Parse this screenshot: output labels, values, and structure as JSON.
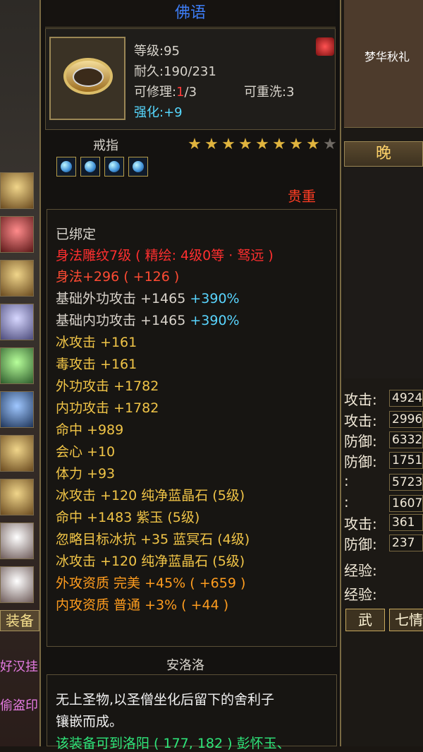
{
  "tooltip": {
    "title": "佛语",
    "level": "等级:95",
    "durability": "耐久:190/231",
    "repair_label": "可修理:",
    "repair_value": "1",
    "repair_total": "/3",
    "rewash": "可重洗:3",
    "enhance_label": "强化:",
    "enhance_value": "+9",
    "item_type": "戒指",
    "stars": 8,
    "total_stars": 9,
    "rarity": "贵重",
    "bound": "已绑定",
    "engraving": "身法雕纹7级 ( 精绘: 4级0等 · 驽远 )",
    "lines": [
      {
        "text": "身法+296 ( +126 )",
        "color": "#ff4b33"
      },
      {
        "text": "基础外功攻击 +1465",
        "extra": " +390%",
        "color": "#d9d3cb",
        "extra_color": "#59d5ff"
      },
      {
        "text": "基础内功攻击 +1465",
        "extra": " +390%",
        "color": "#d9d3cb",
        "extra_color": "#59d5ff"
      },
      {
        "text": "冰攻击 +161",
        "color": "#f0c447"
      },
      {
        "text": "毒攻击 +161",
        "color": "#f0c447"
      },
      {
        "text": "外功攻击 +1782",
        "color": "#f0c447"
      },
      {
        "text": "内功攻击 +1782",
        "color": "#f0c447"
      },
      {
        "text": "命中 +989",
        "color": "#f0c447"
      },
      {
        "text": "会心 +10",
        "color": "#f0c447"
      },
      {
        "text": "体力 +93",
        "color": "#f0c447"
      },
      {
        "text": "冰攻击 +120 纯净蓝晶石 (5级)",
        "color": "#f0c447"
      },
      {
        "text": "命中 +1483 紫玉 (5级)",
        "color": "#f0c447"
      },
      {
        "text": "忽略目标冰抗 +35 蓝冥石 (4级)",
        "color": "#f0c447"
      },
      {
        "text": "冰攻击 +120 纯净蓝晶石 (5级)",
        "color": "#f0c447"
      },
      {
        "text": "外攻资质   完美 +45% ( +659 )",
        "color": "#ff9d1f"
      },
      {
        "text": "内攻资质   普通 +3% ( +44 )",
        "color": "#ff9d1f"
      }
    ],
    "source_title": "安洛洛",
    "description_1": "无上圣物,以圣僧坐化后留下的舍利子",
    "description_2": "镶嵌而成。",
    "description_3": "该装备可到洛阳 ( 177, 182 ) 彭怀玉、"
  },
  "right_panel": {
    "night": "晚",
    "stats": [
      {
        "label": "攻击:",
        "value": "4924"
      },
      {
        "label": "攻击:",
        "value": "2996"
      },
      {
        "label": "防御:",
        "value": "6332"
      },
      {
        "label": "防御:",
        "value": "1751"
      },
      {
        "label": ":",
        "value": "5723"
      },
      {
        "label": ":",
        "value": "1607"
      },
      {
        "label": "攻击:",
        "value": "361"
      },
      {
        "label": "防御:",
        "value": "237"
      }
    ],
    "exp1": "经验:",
    "exp2": "经验:",
    "tab1": "武",
    "tab2": "七情",
    "banner": "梦华秋礼"
  },
  "left_panel": {
    "equip": "装备",
    "text1": "好汉挂",
    "text2": "偷盗印"
  }
}
